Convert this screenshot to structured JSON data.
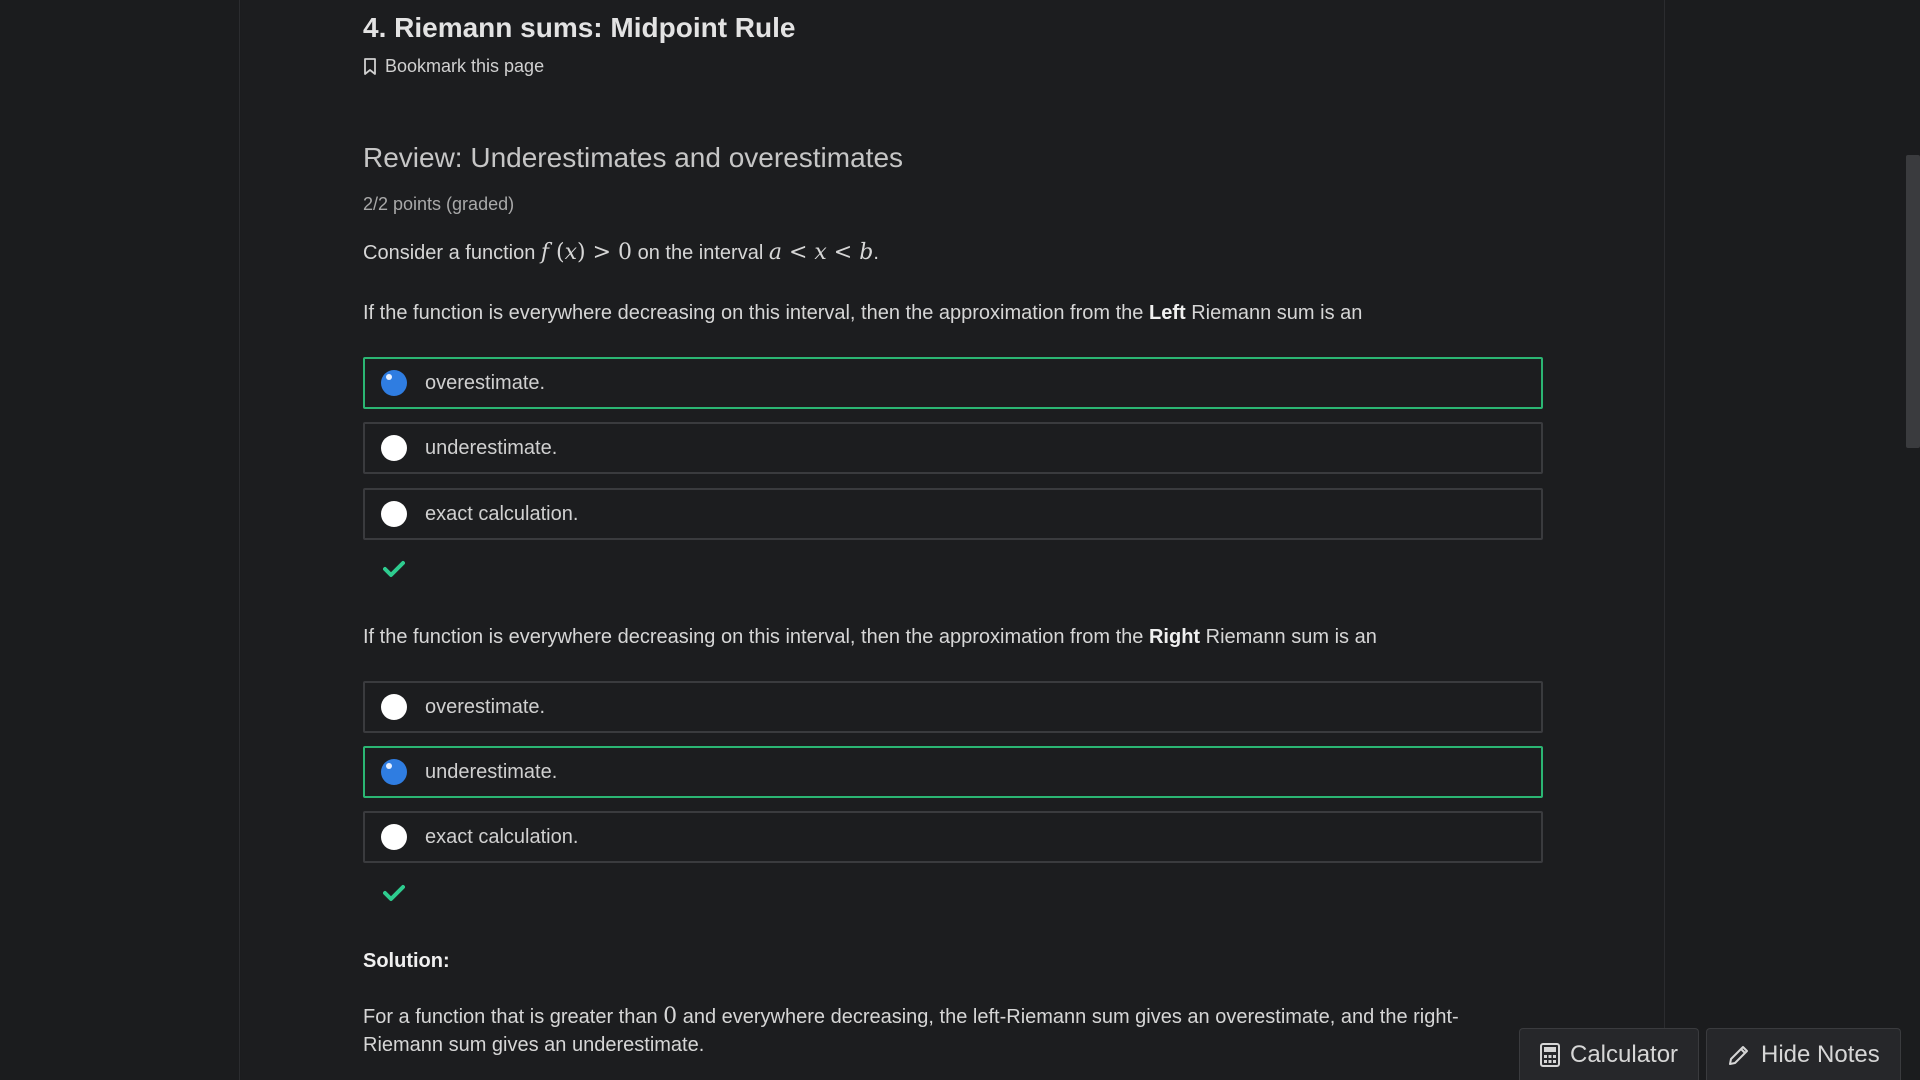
{
  "unit": {
    "title": "4. Riemann sums: Midpoint Rule",
    "bookmark_label": "Bookmark this page"
  },
  "problem": {
    "title": "Review: Underestimates and overestimates",
    "points": "2/2 points (graded)",
    "intro_prefix": "Consider a function",
    "intro_mid": "on the interval",
    "intro_suffix": ".",
    "math_f": "f",
    "math_paren_open": " (",
    "math_x": "x",
    "math_paren_close": ") ",
    "math_gt": "> 0",
    "math_a": "a",
    "math_lt1": " < ",
    "math_x2": "x",
    "math_lt2": " < ",
    "math_b": "b",
    "questions": [
      {
        "prompt_prefix": "If the function is everywhere decreasing on this interval, then the approximation from the ",
        "prompt_bold": "Left",
        "prompt_suffix": " Riemann sum is an",
        "options": [
          "overestimate.",
          "underestimate.",
          "exact calculation."
        ],
        "selected_index": 0,
        "status": "correct"
      },
      {
        "prompt_prefix": "If the function is everywhere decreasing on this interval, then the approximation from the ",
        "prompt_bold": "Right",
        "prompt_suffix": " Riemann sum is an",
        "options": [
          "overestimate.",
          "underestimate.",
          "exact calculation."
        ],
        "selected_index": 1,
        "status": "correct"
      }
    ],
    "solution_heading": "Solution:",
    "solution_prefix": "For a function that is greater than ",
    "solution_math": "0",
    "solution_suffix_line1": " and everywhere decreasing, the left-Riemann sum gives an overestimate, and the right-",
    "solution_line2": "Riemann sum gives an underestimate."
  },
  "tools": {
    "calculator_label": "Calculator",
    "notes_label": "Hide Notes"
  },
  "colors": {
    "correct_border": "#2bb673",
    "radio_selected": "#2f7de1",
    "check": "#2ecc8f"
  },
  "icons": {
    "bookmark": "bookmark-icon",
    "check": "check-icon",
    "calculator": "calculator-icon",
    "pencil": "pencil-icon"
  }
}
